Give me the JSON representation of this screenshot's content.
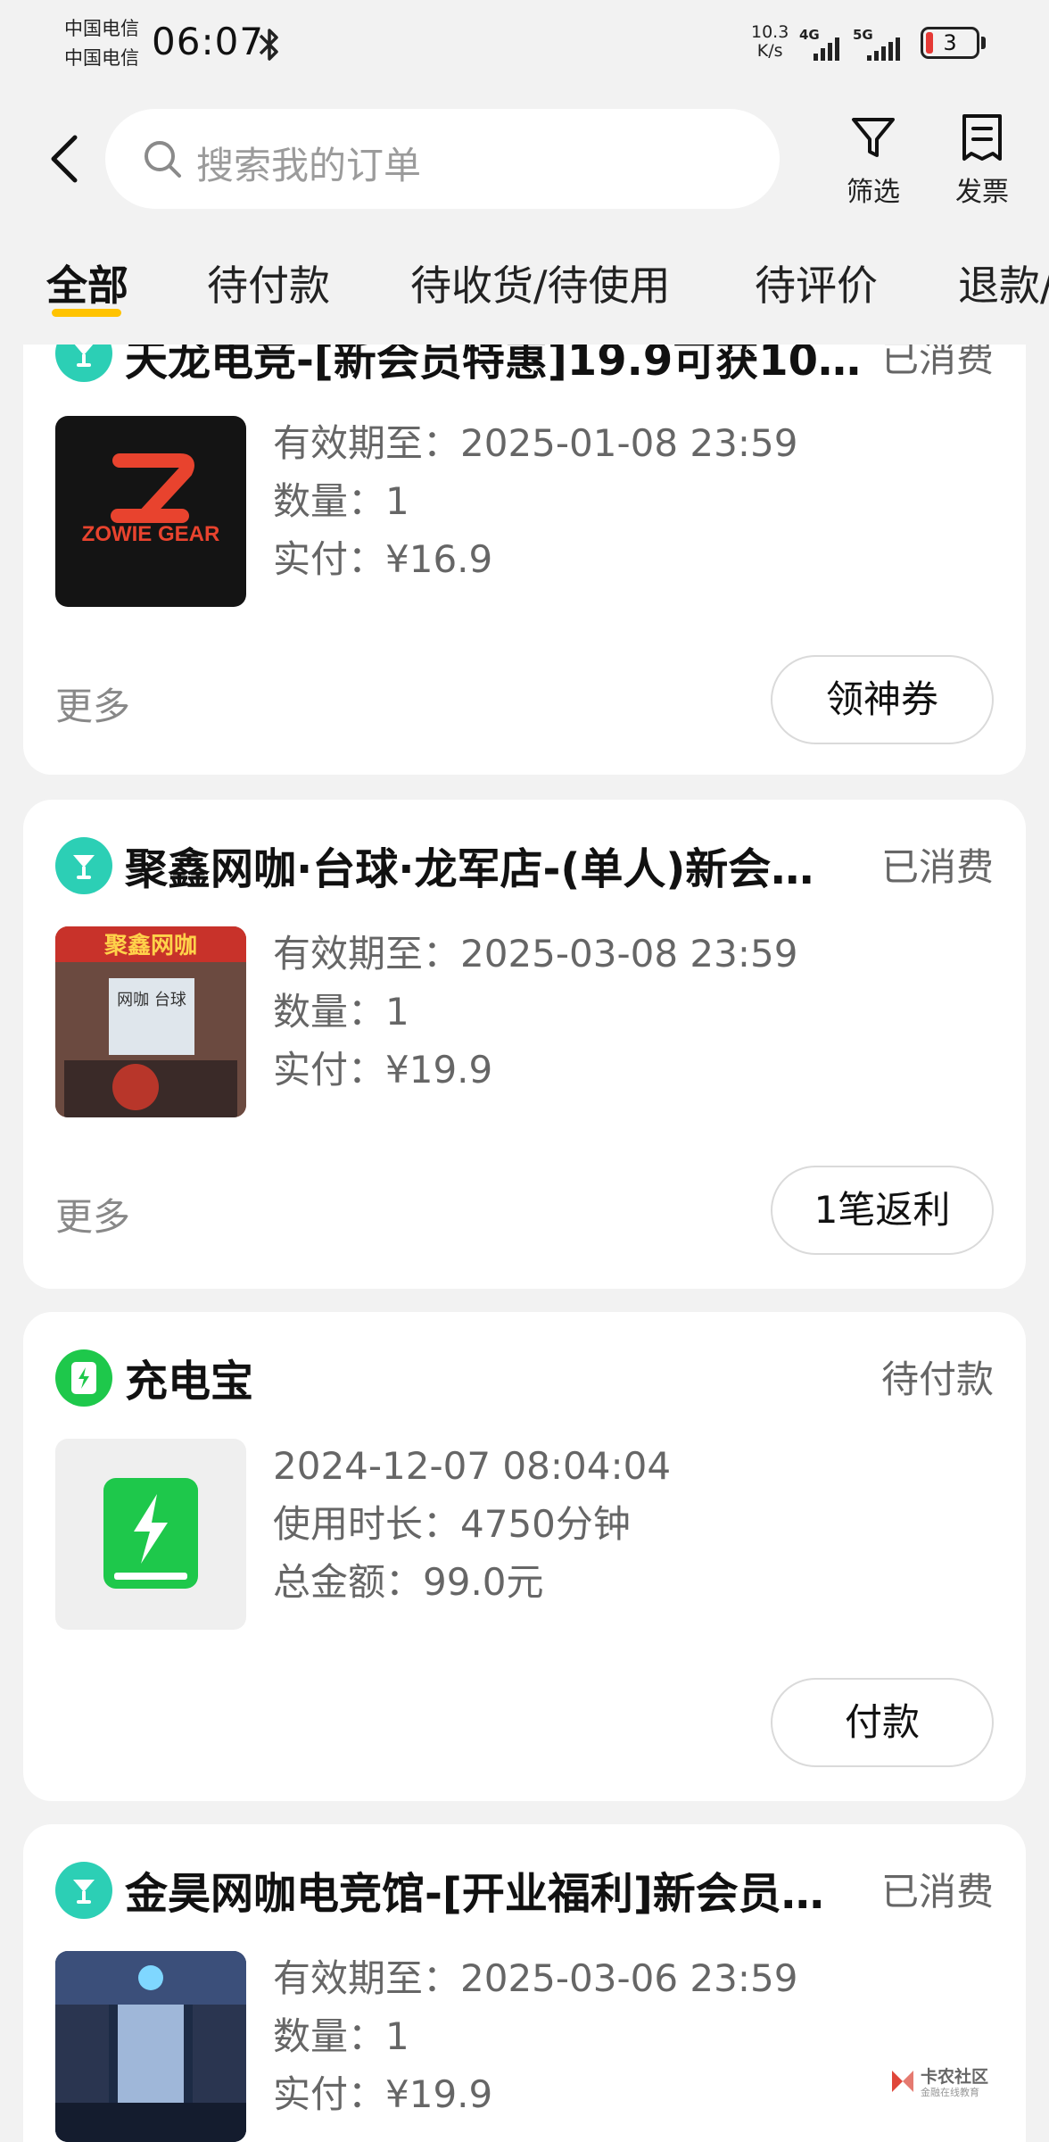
{
  "status_bar": {
    "carrier1": "中国电信",
    "carrier2": "中国电信",
    "time": "06:07",
    "net_speed_value": "10.3",
    "net_speed_unit": "K/s",
    "signal1_label": "4G",
    "signal2_label": "5G",
    "battery_level": "3"
  },
  "header": {
    "search_placeholder": "搜索我的订单",
    "filter_label": "筛选",
    "invoice_label": "发票"
  },
  "tabs": [
    {
      "label": "全部",
      "active": true
    },
    {
      "label": "待付款"
    },
    {
      "label": "待收货/待使用"
    },
    {
      "label": "待评价"
    },
    {
      "label": "退款/"
    }
  ],
  "orders": [
    {
      "title": "天龙电竞-[新会员特惠]19.9可获10…",
      "status": "已消费",
      "thumb_text": "ZOWIE GEAR",
      "line1": "有效期至：2025-01-08 23:59",
      "line2": "数量：1",
      "line3": "实付：¥16.9",
      "more": "更多",
      "action": "领神券"
    },
    {
      "title": "聚鑫网咖·台球·龙军店-(单人)新会…",
      "status": "已消费",
      "thumb_sign": "聚鑫网咖",
      "thumb_sub": "网咖 台球",
      "line1": "有效期至：2025-03-08 23:59",
      "line2": "数量：1",
      "line3": "实付：¥19.9",
      "more": "更多",
      "action": "1笔返利"
    },
    {
      "title": "充电宝",
      "status": "待付款",
      "line1": "2024-12-07 08:04:04",
      "line2": "使用时长：4750分钟",
      "line3": "总金额：99.0元",
      "action": "付款"
    },
    {
      "title": "金昊网咖电竞馆-[开业福利]新会员…",
      "status": "已消费",
      "line1": "有效期至：2025-03-06 23:59",
      "line2": "数量：1",
      "line3": "实付：¥19.9"
    }
  ],
  "watermark": {
    "name": "卡农社区",
    "sub": "金融在线教育"
  },
  "colors": {
    "brand_yellow": "#ffc300",
    "icon_teal": "#2ccfb5",
    "icon_green": "#1ec84b"
  }
}
